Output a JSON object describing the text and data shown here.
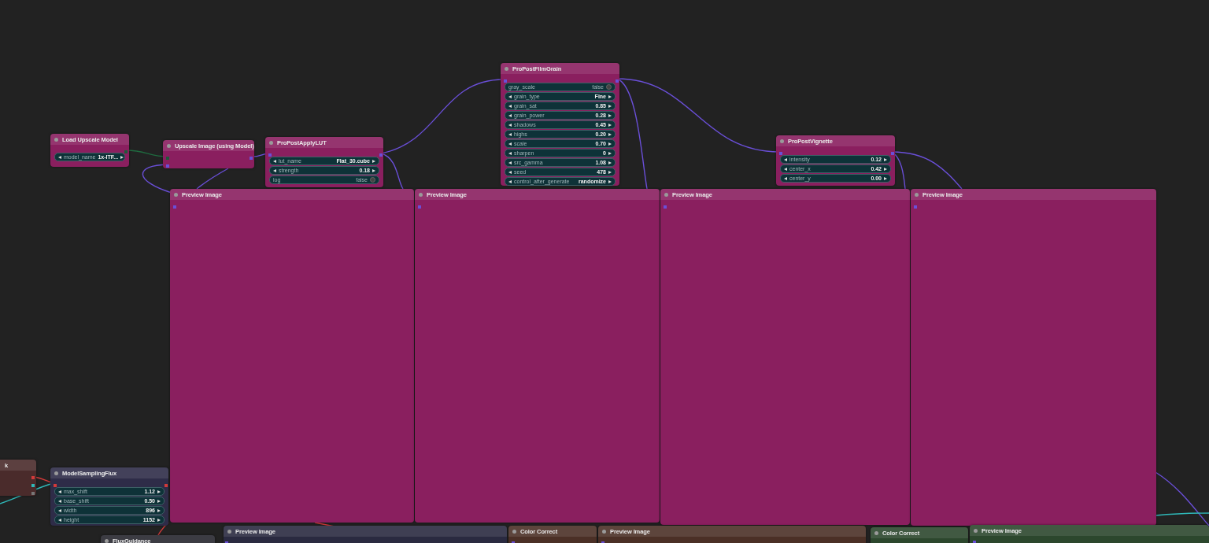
{
  "nodes": [
    {
      "title": "Load Upscale Model",
      "color": "#8a1f5f",
      "widgets": [
        {
          "kind": "combo",
          "label": "model_name",
          "value": "1x-ITF..."
        }
      ]
    },
    {
      "title": "Upscale Image (using Model)",
      "color": "#8a1f5f"
    },
    {
      "title": "ProPostApplyLUT",
      "color": "#8a1f5f",
      "widgets": [
        {
          "kind": "combo",
          "label": "lut_name",
          "value": "Flat_30.cube"
        },
        {
          "kind": "number",
          "label": "strength",
          "value": "0.18"
        },
        {
          "kind": "toggle",
          "label": "log",
          "value": "false",
          "on": false
        }
      ]
    },
    {
      "title": "ProPostFilmGrain",
      "color": "#8a1f5f",
      "widgets": [
        {
          "kind": "toggle",
          "label": "gray_scale",
          "value": "false",
          "on": false
        },
        {
          "kind": "combo",
          "label": "grain_type",
          "value": "Fine"
        },
        {
          "kind": "number",
          "label": "grain_sat",
          "value": "0.85"
        },
        {
          "kind": "number",
          "label": "grain_power",
          "value": "0.28"
        },
        {
          "kind": "number",
          "label": "shadows",
          "value": "0.45"
        },
        {
          "kind": "number",
          "label": "highs",
          "value": "0.20"
        },
        {
          "kind": "number",
          "label": "scale",
          "value": "0.70"
        },
        {
          "kind": "number",
          "label": "sharpen",
          "value": "0"
        },
        {
          "kind": "number",
          "label": "src_gamma",
          "value": "1.08"
        },
        {
          "kind": "number",
          "label": "seed",
          "value": "478"
        },
        {
          "kind": "combo",
          "label": "control_after_generate",
          "value": "randomize"
        }
      ]
    },
    {
      "title": "ProPostVignette",
      "color": "#8a1f5f",
      "widgets": [
        {
          "kind": "number",
          "label": "intensity",
          "value": "0.12"
        },
        {
          "kind": "number",
          "label": "center_x",
          "value": "0.42"
        },
        {
          "kind": "number",
          "label": "center_y",
          "value": "0.00"
        }
      ]
    },
    {
      "title": "Preview Image",
      "color": "#8a1f5f"
    },
    {
      "title": "Preview Image",
      "color": "#8a1f5f"
    },
    {
      "title": "Preview Image",
      "color": "#8a1f5f"
    },
    {
      "title": "Preview Image",
      "color": "#8a1f5f"
    },
    {
      "title": "k",
      "color": "#4a2b2b"
    },
    {
      "title": "ModelSamplingFlux",
      "color": "#2e2c48",
      "widgets": [
        {
          "kind": "number",
          "label": "max_shift",
          "value": "1.12"
        },
        {
          "kind": "number",
          "label": "base_shift",
          "value": "0.50"
        },
        {
          "kind": "number",
          "label": "width",
          "value": "896"
        },
        {
          "kind": "number",
          "label": "height",
          "value": "1152"
        }
      ]
    },
    {
      "title": "Preview Image",
      "color": "#2a2a40"
    },
    {
      "title": "Color Correct",
      "color": "#4b3026"
    },
    {
      "title": "Preview Image",
      "color": "#4b3026"
    },
    {
      "title": "Color Correct",
      "color": "#2c472d"
    },
    {
      "title": "Preview Image",
      "color": "#2c472d"
    },
    {
      "title": "FluxGuidance",
      "color": "#26262e"
    }
  ]
}
